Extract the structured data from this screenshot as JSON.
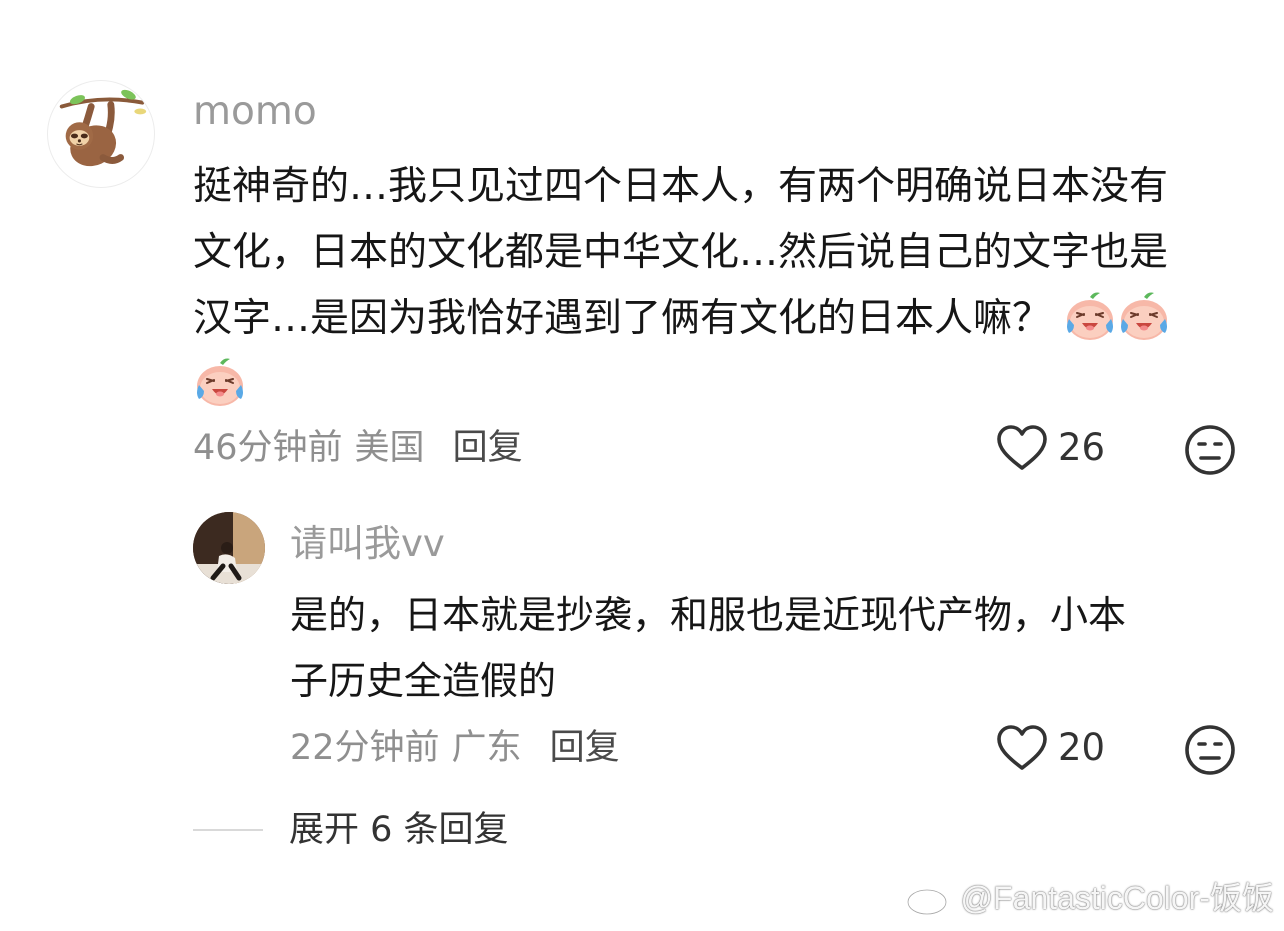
{
  "comment": {
    "username": "momo",
    "avatar": "sloth-avatar",
    "text_lines": [
      "挺神奇的…我只见过四个日本人，有两个明确说日本没有",
      "文化，日本的文化都是中华文化…然后说自己的文字也是",
      "汉字…是因为我恰好遇到了俩有文化的日本人嘛？"
    ],
    "emoji": "laugh-cry-peach-emoji",
    "time": "46分钟前",
    "location": "美国",
    "reply_label": "回复",
    "like_count": "26"
  },
  "reply": {
    "username": "请叫我vv",
    "avatar": "photo-avatar",
    "text_lines": [
      "是的，日本就是抄袭，和服也是近现代产物，小本",
      "子历史全造假的"
    ],
    "time": "22分钟前",
    "location": "广东",
    "reply_label": "回复",
    "like_count": "20"
  },
  "expand_label": "展开 6 条回复",
  "watermark": "@FantasticColor-饭饭"
}
